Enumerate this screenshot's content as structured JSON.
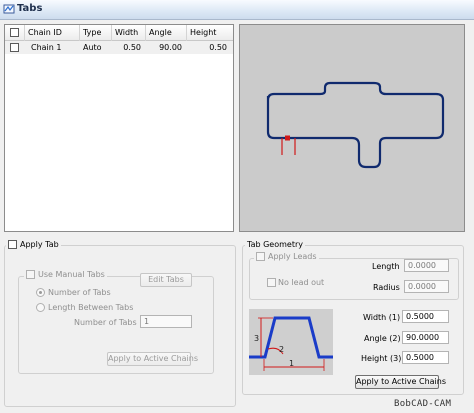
{
  "window": {
    "title": "Tabs"
  },
  "grid": {
    "columns": [
      "Chain ID",
      "Type",
      "Width",
      "Angle",
      "Height"
    ],
    "rows": [
      {
        "chain_id": "Chain 1",
        "type": "Auto",
        "width": "0.50",
        "angle": "90.00",
        "height": "0.50"
      }
    ]
  },
  "apply_tab": {
    "label": "Apply Tab",
    "use_manual_tabs_label": "Use Manual Tabs",
    "edit_tabs_label": "Edit Tabs",
    "number_of_tabs_radio_label": "Number of Tabs",
    "length_between_tabs_label": "Length Between Tabs",
    "number_of_tabs_field_label": "Number of Tabs",
    "number_of_tabs_value": "1",
    "apply_button_label": "Apply to Active Chains"
  },
  "tab_geometry": {
    "title": "Tab Geometry",
    "apply_leads_label": "Apply Leads",
    "length_label": "Length",
    "length_value": "0.0000",
    "no_lead_out_label": "No lead out",
    "radius_label": "Radius",
    "radius_value": "0.0000",
    "width_label": "Width (1)",
    "width_value": "0.5000",
    "angle_label": "Angle (2)",
    "angle_value": "90.0000",
    "height_label": "Height (3)",
    "height_value": "0.5000",
    "diagram_labels": [
      "1",
      "2",
      "3"
    ],
    "apply_button_label": "Apply to Active Chains"
  },
  "watermark": "BobCAD-CAM",
  "colors": {
    "toolpath": "#102a6e",
    "tab_marker": "#d01818",
    "diagram_tab": "#1a3cc8",
    "preview_bg": "#cbcbcb"
  }
}
